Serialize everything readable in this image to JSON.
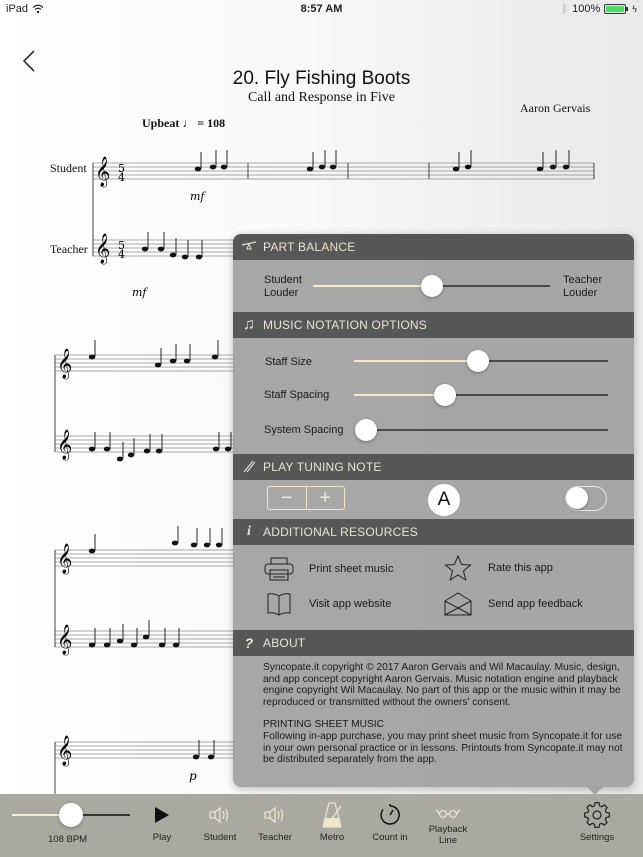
{
  "status_bar": {
    "device": "iPad",
    "time": "8:57 AM",
    "battery": "100%",
    "icons": [
      "wifi-icon",
      "bluetooth-icon",
      "battery-icon",
      "charging-icon"
    ]
  },
  "nav": {
    "back_icon": "chevron-left-icon"
  },
  "score": {
    "title": "20. Fly Fishing Boots",
    "subtitle": "Call and Response in Five",
    "composer": "Aaron Gervais",
    "tempo_label": "Upbeat",
    "tempo_value": "= 108",
    "time_signature": "5/4",
    "parts": [
      "Student",
      "Teacher"
    ],
    "dynamics": [
      "mf",
      "mf",
      "p"
    ]
  },
  "settings_popover": {
    "part_balance": {
      "header": "PART BALANCE",
      "icon": "balance-scale-icon",
      "left_label_1": "Student",
      "left_label_2": "Louder",
      "right_label_1": "Teacher",
      "right_label_2": "Louder",
      "value": 0.5
    },
    "notation": {
      "header": "MUSIC NOTATION OPTIONS",
      "icon": "music-note-icon",
      "sliders": [
        {
          "label": "Staff Size",
          "value": 0.49
        },
        {
          "label": "Staff Spacing",
          "value": 0.36
        },
        {
          "label": "System Spacing",
          "value": 0.0
        }
      ]
    },
    "tuning": {
      "header": "PLAY TUNING NOTE",
      "icon": "tuning-fork-icon",
      "minus": "−",
      "plus": "+",
      "note": "A",
      "toggle_on": false
    },
    "resources": {
      "header": "ADDITIONAL RESOURCES",
      "icon": "info-icon",
      "items": [
        {
          "label": "Print sheet music",
          "icon": "printer-icon"
        },
        {
          "label": "Rate this app",
          "icon": "star-icon"
        },
        {
          "label": "Visit app website",
          "icon": "book-icon"
        },
        {
          "label": "Send app feedback",
          "icon": "envelope-icon"
        }
      ]
    },
    "about": {
      "header": "ABOUT",
      "icon": "question-icon",
      "copyright": "Syncopate.it copyright © 2017 Aaron Gervais and Wil Macaulay. Music, design, and app concept copyright Aaron Gervais. Music notation engine and playback engine copyright Wil Macaulay. No part of this app or the music within it may be reproduced or transmitted without the owners' consent.",
      "printing_heading": "PRINTING SHEET MUSIC",
      "printing_text": "Following in-app purchase, you may print sheet music from Syncopate.it for use in your own personal practice or in lessons. Printouts from Syncopate.it may not be distributed separately from the app."
    }
  },
  "toolbar": {
    "tempo_bpm_label": "108 BPM",
    "tempo_fraction": 0.5,
    "items": [
      {
        "label": "Play",
        "icon": "play-icon"
      },
      {
        "label": "Student",
        "icon": "speaker-icon"
      },
      {
        "label": "Teacher",
        "icon": "speaker-icon"
      },
      {
        "label": "Metro",
        "icon": "metronome-icon"
      },
      {
        "label": "Count in",
        "icon": "timer-icon"
      },
      {
        "label": "Playback Line",
        "icon": "glasses-icon"
      },
      {
        "label": "Settings",
        "icon": "gear-icon"
      }
    ]
  },
  "colors": {
    "header_bg": "#575757",
    "header_text": "#e8e4d6",
    "panel_bg": "#a0a0a0",
    "slider_fill": "#f1ead0",
    "toolbar_bg": "#aaa9a1"
  }
}
